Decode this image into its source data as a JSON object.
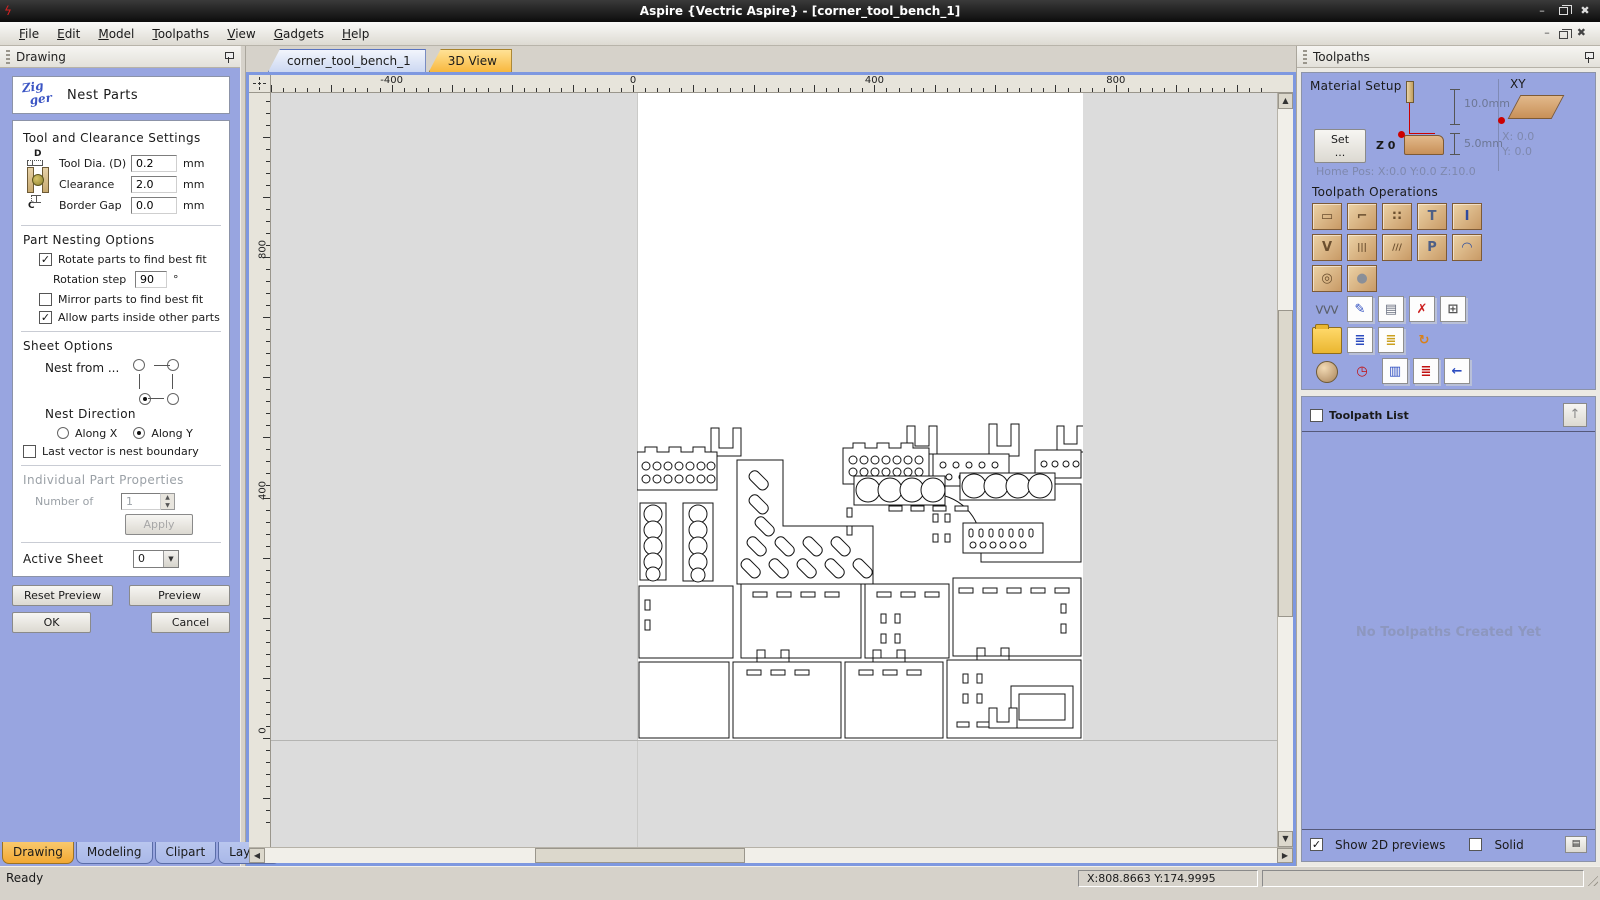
{
  "window": {
    "title": "Aspire {Vectric Aspire} - [corner_tool_bench_1]",
    "app_icon_glyph": "ϟ",
    "minimize_glyph": "–",
    "close_glyph": "✖"
  },
  "menu": {
    "items": [
      "File",
      "Edit",
      "Model",
      "Toolpaths",
      "View",
      "Gadgets",
      "Help"
    ]
  },
  "left_panel": {
    "header": "Drawing",
    "nest_parts": {
      "icon_line1": "Zig",
      "icon_line2": "ger",
      "title": "Nest Parts",
      "tool_clearance": {
        "section_title": "Tool and Clearance Settings",
        "icon_top_label": "D",
        "icon_bottom_label": "C",
        "rows": [
          {
            "label": "Tool Dia. (D)",
            "value": "0.2",
            "unit": "mm"
          },
          {
            "label": "Clearance",
            "value": "2.0",
            "unit": "mm"
          },
          {
            "label": "Border Gap",
            "value": "0.0",
            "unit": "mm"
          }
        ]
      },
      "part_nesting": {
        "section_title": "Part Nesting Options",
        "rotate_label": "Rotate parts to find best fit",
        "rotate_checked": true,
        "rotation_step_label": "Rotation step",
        "rotation_step_value": "90",
        "rotation_step_unit": "°",
        "mirror_label": "Mirror parts to find best fit",
        "mirror_checked": false,
        "allow_label": "Allow parts inside other parts",
        "allow_checked": true
      },
      "sheet_options": {
        "section_title": "Sheet Options",
        "nest_from_label": "Nest from ...",
        "nest_from": {
          "tl": false,
          "tr": false,
          "bl": true,
          "br": false
        },
        "nest_direction_label": "Nest Direction",
        "along_x_label": "Along X",
        "along_x_checked": false,
        "along_y_label": "Along Y",
        "along_y_checked": true,
        "last_vector_label": "Last vector is nest boundary",
        "last_vector_checked": false
      },
      "individual": {
        "section_title": "Individual Part Properties",
        "number_label": "Number of",
        "number_value": "1",
        "apply_label": "Apply"
      },
      "active_sheet_label": "Active Sheet",
      "active_sheet_value": "0"
    },
    "buttons": {
      "reset_preview": "Reset Preview",
      "preview": "Preview",
      "ok": "OK",
      "cancel": "Cancel"
    },
    "tabs": [
      {
        "label": "Drawing",
        "active": true
      },
      {
        "label": "Modeling",
        "active": false
      },
      {
        "label": "Clipart",
        "active": false
      },
      {
        "label": "Layers",
        "active": false
      }
    ]
  },
  "canvas": {
    "tabs": [
      {
        "label": "corner_tool_bench_1",
        "style": "blue"
      },
      {
        "label": "3D View",
        "style": "orange"
      }
    ],
    "ruler_x": [
      "-400",
      "0",
      "400",
      "800"
    ],
    "ruler_y": [
      "800",
      "400",
      "0"
    ]
  },
  "right_panel": {
    "header": "Toolpaths",
    "material": {
      "title": "Material Setup",
      "set_button": "Set ...",
      "z_label": "Z 0",
      "dim_top": "10.0mm",
      "dim_bottom": "5.0mm",
      "home_pos": "Home Pos:  X:0.0 Y:0.0 Z:10.0",
      "xy_label": "XY",
      "x_value": "X: 0.0",
      "y_value": "Y: 0.0"
    },
    "operations_title": "Toolpath Operations",
    "operations_rows": [
      [
        {
          "name": "profile-toolpath-icon",
          "glyph": "▭",
          "color": "#6b4f2f",
          "kind": "wood"
        },
        {
          "name": "pocket-toolpath-icon",
          "glyph": "⌐",
          "color": "#6b4f2f",
          "kind": "wood"
        },
        {
          "name": "drilling-toolpath-icon",
          "glyph": "∷",
          "color": "#6b4f2f",
          "kind": "wood"
        },
        {
          "name": "quick-engrave-toolpath-icon",
          "glyph": "T",
          "color": "#4d5f86",
          "kind": "wood"
        },
        {
          "name": "inlay-toolpath-icon",
          "glyph": "I",
          "color": "#2f4a9e",
          "kind": "wood"
        }
      ],
      [
        {
          "name": "vcarve-toolpath-icon",
          "glyph": "V",
          "color": "#6b4f2f",
          "kind": "wood"
        },
        {
          "name": "fluting-toolpath-icon",
          "glyph": "|||",
          "color": "#6b4f2f",
          "kind": "wood"
        },
        {
          "name": "texture-toolpath-icon",
          "glyph": "///",
          "color": "#6b4f2f",
          "kind": "wood"
        },
        {
          "name": "prism-carve-toolpath-icon",
          "glyph": "P",
          "color": "#4d5f86",
          "kind": "wood"
        },
        {
          "name": "moulding-toolpath-icon",
          "glyph": "◠",
          "color": "#30509e",
          "kind": "wood"
        }
      ],
      [
        {
          "name": "rough-machining-toolpath-icon",
          "glyph": "◎",
          "color": "#6b4f2f",
          "kind": "wood"
        },
        {
          "name": "finish-machining-toolpath-icon",
          "glyph": "●",
          "color": "#8a8f98",
          "kind": "wood"
        }
      ],
      [
        {
          "name": "tool-database-icon",
          "glyph": "⋁⋁⋁",
          "color": "#5a5f6a",
          "kind": "plain"
        },
        {
          "name": "edit-toolpath-icon",
          "glyph": "✎",
          "color": "#2b4bbf",
          "kind": "doc"
        },
        {
          "name": "merge-toolpaths-icon",
          "glyph": "▤",
          "color": "#6a7080",
          "kind": "doc"
        },
        {
          "name": "delete-toolpath-icon",
          "glyph": "✗",
          "color": "#cc1f1f",
          "kind": "doc"
        },
        {
          "name": "estimate-machining-times-icon",
          "glyph": "⊞",
          "color": "#555555",
          "kind": "doc"
        }
      ],
      [
        {
          "name": "load-toolpath-template-icon",
          "glyph": "",
          "color": "#8f6d1c",
          "kind": "folder"
        },
        {
          "name": "save-toolpath-template-icon",
          "glyph": "≣",
          "color": "#2b4bbf",
          "kind": "doc"
        },
        {
          "name": "save-all-templates-icon",
          "glyph": "≣",
          "color": "#caa020",
          "kind": "doc"
        },
        {
          "name": "recalculate-toolpaths-icon",
          "glyph": "↻",
          "color": "#d98018",
          "kind": "plain"
        }
      ],
      [
        {
          "name": "preview-toolpaths-icon",
          "glyph": "",
          "color": "#6b4f2f",
          "kind": "ball"
        },
        {
          "name": "machining-time-icon",
          "glyph": "◷",
          "color": "#c11111",
          "kind": "plain"
        },
        {
          "name": "simulation-quality-icon",
          "glyph": "▥",
          "color": "#2b4bbf",
          "kind": "doc"
        },
        {
          "name": "save-toolpaths-icon",
          "glyph": "≣",
          "color": "#c11111",
          "kind": "doc"
        },
        {
          "name": "switch-panel-side-icon",
          "glyph": "←",
          "color": "#2b4bbf",
          "kind": "doc"
        }
      ]
    ],
    "toolpath_list": {
      "title": "Toolpath List",
      "checkbox_checked": false,
      "up_button_glyph": "↑",
      "empty_text": "No Toolpaths Created Yet"
    },
    "footer": {
      "show_2d_label": "Show 2D previews",
      "show_2d_checked": true,
      "solid_label": "Solid",
      "solid_checked": false,
      "mini_button_glyph": "▤"
    }
  },
  "status_bar": {
    "ready": "Ready",
    "coords": "X:808.8663 Y:174.9995",
    "extra": ""
  }
}
